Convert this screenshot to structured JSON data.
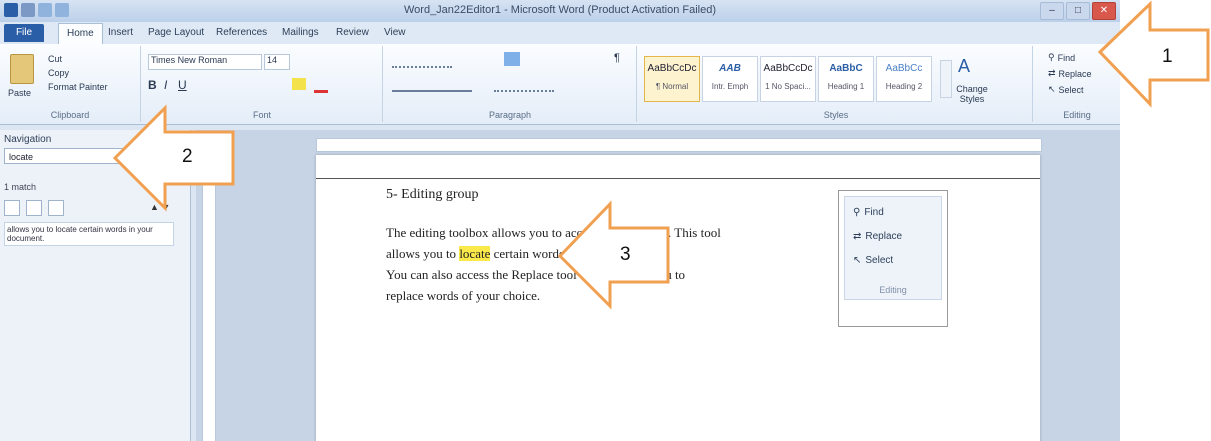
{
  "window": {
    "title": "Word_Jan22Editor1 - Microsoft Word (Product Activation Failed)",
    "controls": [
      "–",
      "□",
      "✕"
    ]
  },
  "tabs": [
    "File",
    "Home",
    "Insert",
    "Page Layout",
    "References",
    "Mailings",
    "Review",
    "View"
  ],
  "ribbon": {
    "clipboard": {
      "paste": "Paste",
      "cut": "Cut",
      "copy": "Copy",
      "format_painter": "Format Painter",
      "label": "Clipboard"
    },
    "font": {
      "name": "Times New Roman",
      "size": "14",
      "label": "Font"
    },
    "paragraph": {
      "label": "Paragraph"
    },
    "styles": {
      "items": [
        {
          "sample": "AaBbCcDc",
          "name": "¶ Normal"
        },
        {
          "sample": "AAB",
          "name": "Intr. Emph"
        },
        {
          "sample": "AaBbCcDc",
          "name": "1 No Spaci..."
        },
        {
          "sample": "AaBbC",
          "name": "Heading 1"
        },
        {
          "sample": "AaBbCc",
          "name": "Heading 2"
        }
      ],
      "change_styles": "Change Styles",
      "label": "Styles"
    },
    "editing": {
      "find": "Find",
      "replace": "Replace",
      "select": "Select",
      "label": "Editing"
    }
  },
  "navigation": {
    "title": "Navigation",
    "search_value": "locate",
    "match_count": "1 match",
    "result_text": "allows you to locate certain words in your document."
  },
  "document": {
    "heading": "5- Editing group",
    "lines": [
      "The editing toolbox allows you to access the Find tool. This tool",
      "allows you to ",
      "locate",
      " certain words in your document.",
      "You can also access the Replace tool which allows you to",
      "replace words of your choice."
    ],
    "panel": {
      "find": "Find",
      "replace": "Replace",
      "select": "Select",
      "label": "Editing"
    }
  },
  "annotations": {
    "arrow_1": "1",
    "arrow_2": "2",
    "arrow_3": "3",
    "arrow_color": "#f0a050"
  }
}
